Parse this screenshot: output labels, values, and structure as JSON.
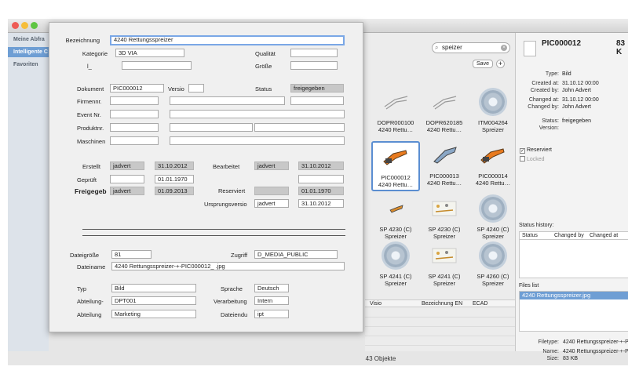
{
  "sidebar": {
    "items": [
      {
        "label": "Meine Abfra",
        "active": false
      },
      {
        "label": "Intelligente C",
        "active": true
      },
      {
        "label": "Favoriten",
        "active": false
      }
    ]
  },
  "search": {
    "value": "speizer"
  },
  "toolbar": {
    "save_label": "Save",
    "add_label": "+"
  },
  "tiles": [
    {
      "line1": "DOPR000100",
      "line2": "4240 Rettu…",
      "icon": "spreader-sketch-icon",
      "selected": false
    },
    {
      "line1": "DOPR620185",
      "line2": "4240 Rettu…",
      "icon": "spreader-sketch-icon",
      "selected": false
    },
    {
      "line1": "ITM004264",
      "line2": "Spreizer",
      "icon": "gear-icon",
      "selected": false
    },
    {
      "line1": "PIC000012",
      "line2": "4240 Rettu…",
      "icon": "spreader-orange-icon",
      "selected": true
    },
    {
      "line1": "PIC000013",
      "line2": "4240 Rettu…",
      "icon": "spreader-blue-icon",
      "selected": false
    },
    {
      "line1": "PIC000014",
      "line2": "4240 Rettu…",
      "icon": "spreader-orange-icon",
      "selected": false
    },
    {
      "line1": "SP 4230 (C)",
      "line2": "Spreizer",
      "icon": "spreader-small-icon",
      "selected": false
    },
    {
      "line1": "SP 4230 (C)",
      "line2": "Spreizer",
      "icon": "parts-sheet-icon",
      "selected": false
    },
    {
      "line1": "SP 4240 (C)",
      "line2": "Spreizer",
      "icon": "gear-icon",
      "selected": false
    },
    {
      "line1": "SP 4241 (C)",
      "line2": "Spreizer",
      "icon": "gear-icon",
      "selected": false
    },
    {
      "line1": "SP 4241 (C)",
      "line2": "Spreizer",
      "icon": "parts-sheet-icon",
      "selected": false
    },
    {
      "line1": "SP 4260 (C)",
      "line2": "Spreizer",
      "icon": "gear-icon",
      "selected": false
    }
  ],
  "list_columns": [
    "Visio",
    "Bezeichnung EN",
    "ECAD"
  ],
  "status_bar": "43 Objekte",
  "inspector": {
    "title": "PIC000012",
    "size_short": "83 K",
    "meta": [
      {
        "key": "Type:",
        "value": "Bild"
      },
      {
        "key": "Created at:",
        "value": "31.10.12 00:00"
      },
      {
        "key": "Created by:",
        "value": "John Advert"
      },
      {
        "key": "Changed at:",
        "value": "31.10.12 00:00"
      },
      {
        "key": "Changed by:",
        "value": "John Advert"
      },
      {
        "key": "Status:",
        "value": "freigegeben"
      },
      {
        "key": "Version:",
        "value": ""
      }
    ],
    "reserved_label": "Reserviert",
    "reserved_checked": true,
    "locked_label": "Locked",
    "locked_checked": false,
    "status_history_label": "Status history:",
    "status_history_columns": [
      "Status",
      "Changed by",
      "Changed at"
    ],
    "files_list_label": "Files list",
    "files": [
      "4240 Rettungsspreizer.jpg"
    ],
    "file_meta": [
      {
        "key": "Filetype:",
        "value": "4240 Rettungsspreizer-+-PI"
      },
      {
        "key": "Name:",
        "value": "4240 Rettungsspreizer-+-PI"
      },
      {
        "key": "Size:",
        "value": "83 KB"
      }
    ]
  },
  "sheet": {
    "bezeichnung_label": "Bezeichnung",
    "bezeichnung_value": "4240 Rettungsspreizer",
    "kategorie_label": "Kategorie",
    "kategorie_value": "3D VIA",
    "qualitaet_label": "Qualität",
    "qualitaet_value": "",
    "groesse_label": "Größe",
    "groesse_value": "",
    "small_label": "l_",
    "dokument_label": "Dokument",
    "dokument_value": "PIC000012",
    "version_label": "Versio",
    "version_value": "",
    "status_label": "Status",
    "status_value": "freigegeben",
    "firmennr_label": "Firmennr.",
    "eventnr_label": "Event Nr.",
    "produktnr_label": "Produktnr.",
    "maschinen_label": "Maschinen",
    "erstellt_label": "Erstellt",
    "erstellt_user": "jadvert",
    "erstellt_date": "31.10.2012",
    "bearbeitet_label": "Bearbeitet",
    "bearbeitet_user": "jadvert",
    "bearbeitet_date": "31.10.2012",
    "geprueft_label": "Geprüft",
    "geprueft_user": "",
    "geprueft_date": "01.01.1970",
    "freigegeb_label": "Freigegeb",
    "freigegeb_user": "jadvert",
    "freigegeb_date": "01.09.2013",
    "reserviert_label": "Reserviert",
    "reserviert_user": "",
    "reserviert_date": "01.01.1970",
    "ursprung_label": "Ursprungsversio",
    "ursprung_user": "jadvert",
    "ursprung_date": "31.10.2012",
    "dateigroesse_label": "Dateigröße",
    "dateigroesse_value": "81",
    "zugriff_label": "Zugriff",
    "zugriff_value": "D_MEDIA_PUBLIC",
    "dateiname_label": "Dateiname",
    "dateiname_value": "4240 Rettungsspreizer-+-PIC000012_ .jpg",
    "typ_label": "Typ",
    "typ_value": "Bild",
    "sprache_label": "Sprache",
    "sprache_value": "Deutsch",
    "abteilung2_label": "Abteilung-",
    "abteilung2_value": "DPT001",
    "verarbeitung_label": "Verarbeitung",
    "verarbeitung_value": "Intern",
    "abteilung_label": "Abteilung",
    "abteilung_value": "Marketing",
    "dateiendu_label": "Dateiendu",
    "dateiendu_value": "ipt"
  }
}
